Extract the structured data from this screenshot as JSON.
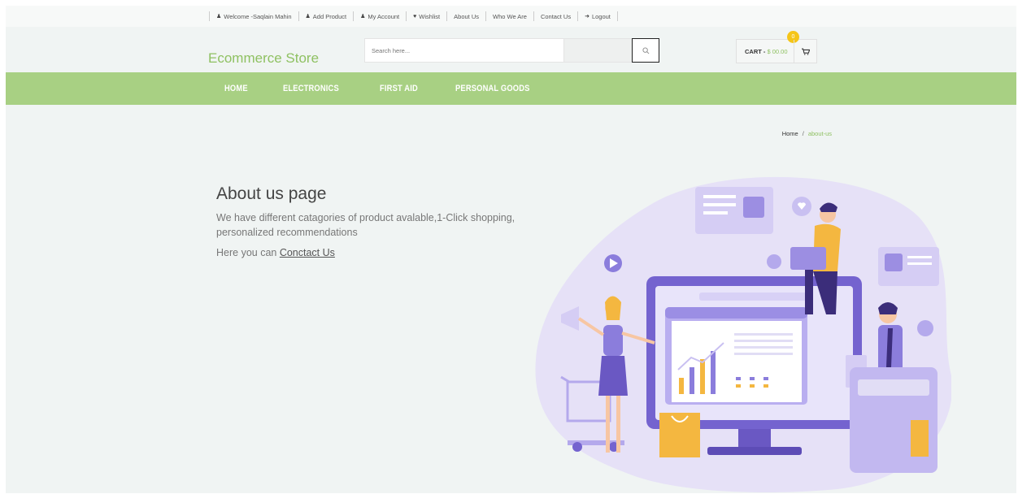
{
  "topbar": {
    "links": [
      {
        "icon": "user-icon",
        "label": "Welcome -Saqlain Mahin"
      },
      {
        "icon": "user-icon",
        "label": "Add Product"
      },
      {
        "icon": "user-icon",
        "label": "My Account"
      },
      {
        "icon": "heart-icon",
        "label": "Wishlist"
      },
      {
        "icon": "",
        "label": "About Us"
      },
      {
        "icon": "",
        "label": "Who We Are"
      },
      {
        "icon": "",
        "label": "Contact Us"
      },
      {
        "icon": "logout-icon",
        "label": "Logout"
      }
    ]
  },
  "header": {
    "brand": "Ecommerce Store",
    "search_placeholder": "Search here...",
    "cart_label": "CART - ",
    "cart_amount": "$ 00.00",
    "cart_count": "0"
  },
  "nav": {
    "items": [
      "HOME",
      "ELECTRONICS",
      "FIRST AID",
      "PERSONAL GOODS"
    ]
  },
  "breadcrumb": {
    "home": "Home",
    "separator": "/",
    "current": "about-us"
  },
  "content": {
    "title": "About us page",
    "description": "We have different catagories of product avalable,1-Click shopping, personalized recommendations",
    "contact_prefix": "Here you can ",
    "contact_link": "Conctact Us"
  },
  "colors": {
    "accent_green": "#a8d083",
    "brand_green": "#8fc162",
    "badge_yellow": "#f5c518",
    "illustration_purple": "#7b6bd6"
  }
}
